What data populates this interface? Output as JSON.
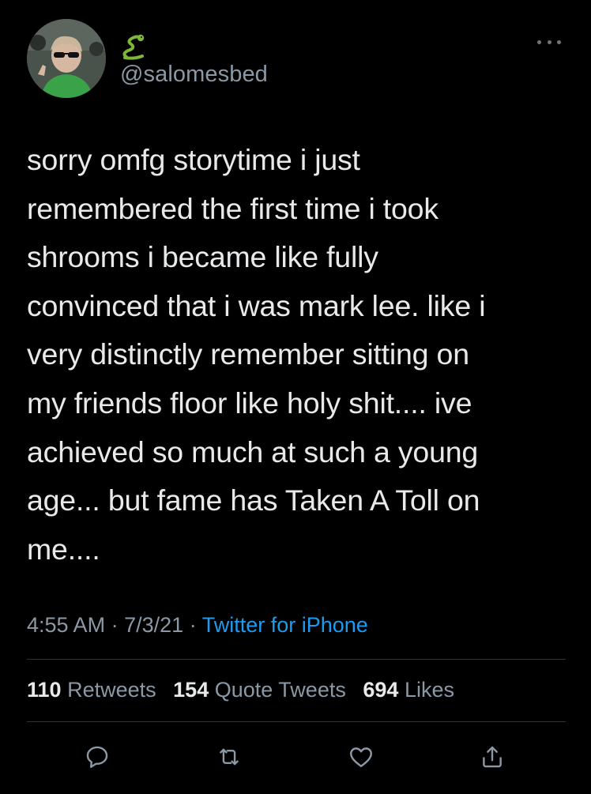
{
  "tweet": {
    "author": {
      "handle": "@salomesbed",
      "name_icon": "snake-emoji"
    },
    "text": "sorry omfg storytime i just\nremembered the first time i took\nshrooms i became like fully\nconvinced that i was mark lee. like i\nvery distinctly remember sitting on\nmy friends floor like holy shit.... ive\nachieved so much at such a young\nage... but fame has Taken A Toll on\nme....",
    "time": "4:55 AM",
    "date": "7/3/21",
    "separator": "·",
    "source": "Twitter for iPhone",
    "stats": {
      "retweets_count": "110",
      "retweets_label": "Retweets",
      "quotes_count": "154",
      "quotes_label": "Quote Tweets",
      "likes_count": "694",
      "likes_label": "Likes"
    },
    "actions": [
      "reply-icon",
      "retweet-icon",
      "like-icon",
      "share-icon"
    ]
  },
  "colors": {
    "background": "#000000",
    "text": "#e7e9ea",
    "secondary": "#8b98a5",
    "link": "#1d9bf0",
    "divider": "#2f3336"
  }
}
